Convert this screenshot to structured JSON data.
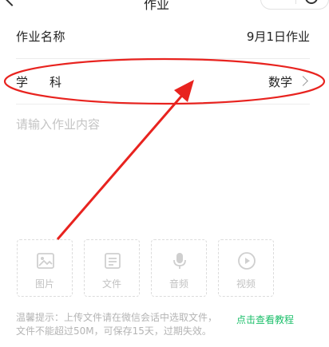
{
  "header": {
    "title_fragment": "作业"
  },
  "form": {
    "name_label": "作业名称",
    "name_value": "9月1日作业",
    "subject_label": "学科",
    "subject_value": "数学",
    "content_placeholder": "请输入作业内容"
  },
  "attachments": [
    {
      "label": "图片",
      "icon": "image-icon"
    },
    {
      "label": "文件",
      "icon": "file-icon"
    },
    {
      "label": "音频",
      "icon": "microphone-icon"
    },
    {
      "label": "视频",
      "icon": "play-icon"
    }
  ],
  "tip": {
    "line1": "温馨提示：上传文件请在微信会话中选取文件，",
    "line2": "文件不能超过50M，可保存15天，过期失效。",
    "link": "点击查看教程"
  },
  "annotation": {
    "color": "#e8231f"
  },
  "colors": {
    "link": "#1bbf6a",
    "placeholder": "#c4c4c4"
  }
}
